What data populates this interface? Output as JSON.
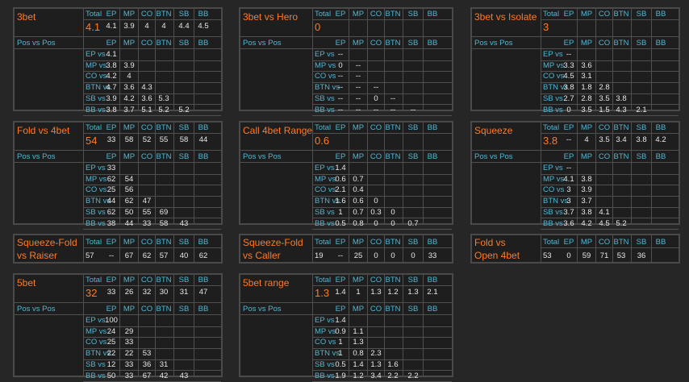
{
  "labels": {
    "total": "Total",
    "pos_vs_pos": "Pos vs Pos"
  },
  "positions": [
    "EP",
    "MP",
    "CO",
    "BTN",
    "SB",
    "BB"
  ],
  "rows": [
    "EP vs",
    "MP vs",
    "CO vs",
    "BTN vs",
    "SB vs",
    "BB vs"
  ],
  "panels": [
    {
      "id": "3bet",
      "title": [
        "3bet"
      ],
      "total": "4.1",
      "head": [
        "4.1",
        "3.9",
        "4",
        "4",
        "4.4",
        "4.5"
      ],
      "matrix": [
        [
          "4.1"
        ],
        [
          "3.8",
          "3.9"
        ],
        [
          "4.2",
          "4"
        ],
        [
          "4.7",
          "3.6",
          "4.3"
        ],
        [
          "3.9",
          "4.2",
          "3.6",
          "5.3"
        ],
        [
          "3.8",
          "3.7",
          "5.1",
          "5.2",
          "5.2"
        ]
      ]
    },
    {
      "id": "3bet-vs-hero",
      "title": [
        "3bet vs Hero"
      ],
      "total": "0",
      "head": [
        "",
        "",
        "",
        "",
        "",
        ""
      ],
      "matrix": [
        [
          "--"
        ],
        [
          "0",
          "--"
        ],
        [
          "--",
          "--"
        ],
        [
          "--",
          "--",
          "--"
        ],
        [
          "--",
          "--",
          "0",
          "--"
        ],
        [
          "--",
          "--",
          "--",
          "--",
          "--"
        ]
      ]
    },
    {
      "id": "3bet-vs-isolate",
      "title": [
        "3bet vs Isolate"
      ],
      "total": "3",
      "head": [
        "",
        "",
        "",
        "",
        "",
        ""
      ],
      "matrix": [
        [
          "--"
        ],
        [
          "3.3",
          "3.6"
        ],
        [
          "4.5",
          "3.1"
        ],
        [
          "3.8",
          "1.8",
          "2.8"
        ],
        [
          "2.7",
          "2.8",
          "3.5",
          "3.8"
        ],
        [
          "0",
          "3.5",
          "1.5",
          "4.3",
          "2.1"
        ]
      ]
    },
    {
      "id": "fold-vs-4bet",
      "title": [
        "Fold vs 4bet"
      ],
      "total": "54",
      "head": [
        "33",
        "58",
        "52",
        "55",
        "58",
        "44"
      ],
      "matrix": [
        [
          "33"
        ],
        [
          "62",
          "54"
        ],
        [
          "25",
          "56"
        ],
        [
          "44",
          "62",
          "47"
        ],
        [
          "62",
          "50",
          "55",
          "69"
        ],
        [
          "38",
          "44",
          "33",
          "58",
          "43"
        ]
      ]
    },
    {
      "id": "call-4bet-range",
      "title": [
        "Call 4bet Range"
      ],
      "total": "0.6",
      "head": [
        "",
        "",
        "",
        "",
        "",
        ""
      ],
      "matrix": [
        [
          "1.4"
        ],
        [
          "0.6",
          "0.7"
        ],
        [
          "2.1",
          "0.4"
        ],
        [
          "1.6",
          "0.6",
          "0"
        ],
        [
          "1",
          "0.7",
          "0.3",
          "0"
        ],
        [
          "0.5",
          "0.8",
          "0",
          "0",
          "0.7"
        ]
      ]
    },
    {
      "id": "squeeze",
      "title": [
        "Squeeze"
      ],
      "total": "3.8",
      "head": [
        "--",
        "4",
        "3.5",
        "3.4",
        "3.8",
        "4.2"
      ],
      "matrix": [
        [
          "--"
        ],
        [
          "4.1",
          "3.8"
        ],
        [
          "3",
          "3.9"
        ],
        [
          "3",
          "3.7"
        ],
        [
          "3.7",
          "3.8",
          "4.1"
        ],
        [
          "3.6",
          "4.2",
          "4.5",
          "5.2"
        ]
      ]
    },
    {
      "id": "squeeze-fold-raiser",
      "title": [
        "Squeeze-Fold",
        "vs Raiser"
      ],
      "total": "57",
      "head": [
        "--",
        "67",
        "62",
        "57",
        "40",
        "62"
      ]
    },
    {
      "id": "squeeze-fold-caller",
      "title": [
        "Squeeze-Fold",
        "vs Caller"
      ],
      "total": "19",
      "head": [
        "--",
        "25",
        "0",
        "0",
        "0",
        "33"
      ]
    },
    {
      "id": "fold-vs-open-4bet",
      "title": [
        "Fold vs",
        "Open 4bet"
      ],
      "total": "53",
      "head": [
        "0",
        "59",
        "71",
        "53",
        "36",
        ""
      ]
    },
    {
      "id": "5bet",
      "title": [
        "5bet"
      ],
      "total": "32",
      "head": [
        "33",
        "26",
        "32",
        "30",
        "31",
        "47"
      ],
      "matrix": [
        [
          "100"
        ],
        [
          "24",
          "29"
        ],
        [
          "25",
          "33"
        ],
        [
          "22",
          "22",
          "53"
        ],
        [
          "12",
          "33",
          "36",
          "31"
        ],
        [
          "50",
          "33",
          "67",
          "42",
          "43"
        ]
      ]
    },
    {
      "id": "5bet-range",
      "title": [
        "5bet range"
      ],
      "total": "1.3",
      "head": [
        "1.4",
        "1",
        "1.3",
        "1.2",
        "1.3",
        "2.1"
      ],
      "matrix": [
        [
          "1.4"
        ],
        [
          "0.9",
          "1.1"
        ],
        [
          "1",
          "1.3"
        ],
        [
          "1",
          "0.8",
          "2.3"
        ],
        [
          "0.5",
          "1.4",
          "1.3",
          "1.6"
        ],
        [
          "1.9",
          "1.2",
          "3.4",
          "2.2",
          "2.2"
        ]
      ]
    }
  ]
}
